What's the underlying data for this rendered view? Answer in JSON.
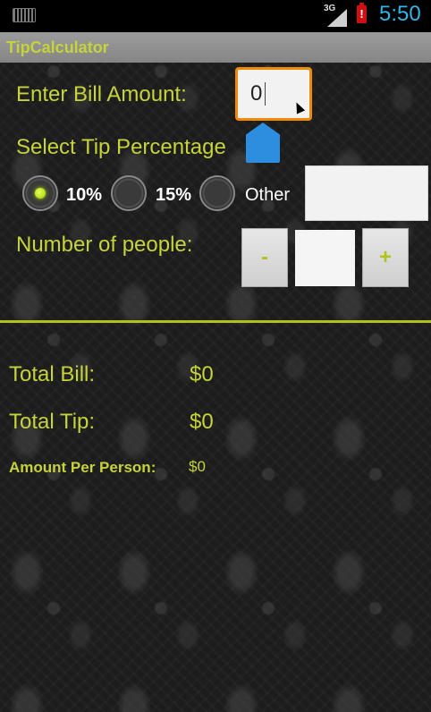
{
  "status_bar": {
    "network_type": "3G",
    "time": "5:50"
  },
  "app": {
    "title": "TipCalculator"
  },
  "bill": {
    "label": "Enter Bill Amount:",
    "value": "0"
  },
  "tip": {
    "label": "Select Tip Percentage",
    "options": [
      "10%",
      "15%",
      "Other"
    ],
    "selected": "10%",
    "other_value": ""
  },
  "people": {
    "label": "Number of people:",
    "minus_label": "-",
    "plus_label": "+",
    "value": ""
  },
  "results": {
    "total_bill_label": "Total Bill:",
    "total_bill_value": "$0",
    "total_tip_label": "Total Tip:",
    "total_tip_value": "$0",
    "per_person_label": "Amount Per Person:",
    "per_person_value": "$0"
  },
  "colors": {
    "accent": "#c6d33a",
    "focus_border": "#f08a00",
    "clock": "#33b5e5"
  },
  "icons": {
    "keyboard": "keyboard-icon",
    "signal": "signal-icon",
    "battery": "battery-alert-icon"
  }
}
